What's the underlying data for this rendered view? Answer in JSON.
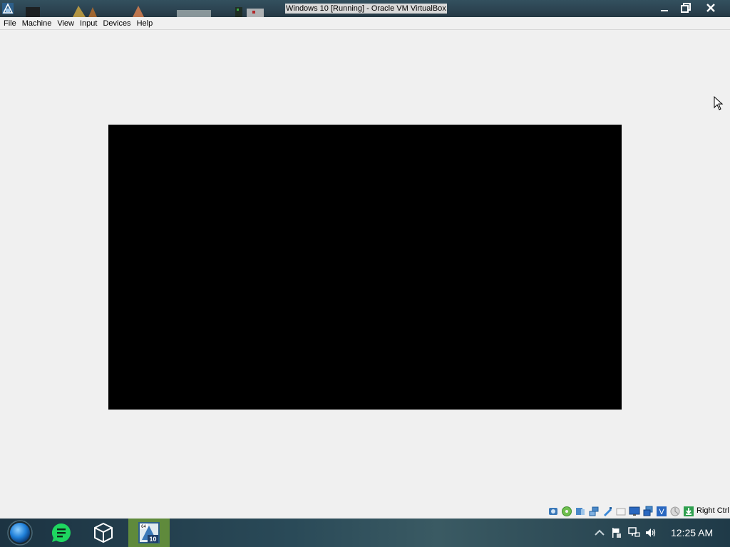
{
  "window": {
    "title": "Windows 10 [Running] - Oracle VM VirtualBox"
  },
  "menu": {
    "items": [
      "File",
      "Machine",
      "View",
      "Input",
      "Devices",
      "Help"
    ]
  },
  "statusbar": {
    "icons": [
      "hard-disk-icon",
      "optical-drive-icon",
      "audio-icon",
      "network-icon",
      "usb-icon",
      "shared-folders-icon",
      "display-icon",
      "video-capture-icon",
      "virtualization-icon",
      "mouse-integration-icon",
      "keyboard-icon"
    ],
    "host_key": "Right Ctrl"
  },
  "taskbar": {
    "clock": "12:25 AM",
    "apps": [
      "start-orb-icon",
      "chat-app-icon",
      "virtualbox-icon",
      "windows10-vm-icon"
    ]
  },
  "colors": {
    "accent_active_task": "#5f8a3c",
    "vm_screen": "#000000"
  }
}
